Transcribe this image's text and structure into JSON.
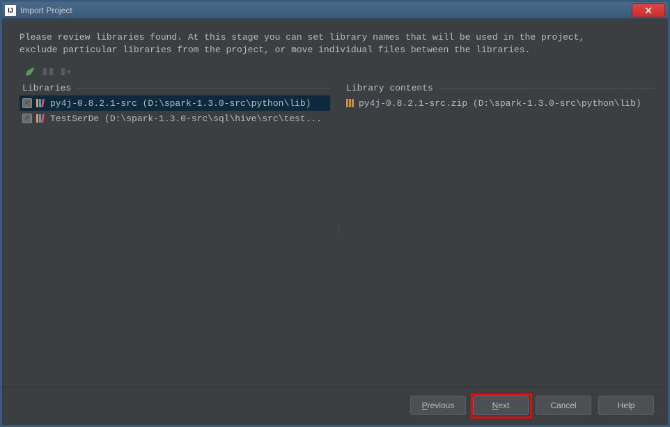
{
  "window": {
    "title": "Import Project",
    "app_icon_text": "IJ"
  },
  "instructions": {
    "line1": "Please review libraries found. At this stage you can set library names that will be used in the project,",
    "line2": "exclude particular libraries from the project, or move individual files between the libraries."
  },
  "toolbar": {
    "rename_icon": "rename",
    "split_icon": "split",
    "merge_icon": "merge"
  },
  "panels": {
    "libraries_label": "Libraries",
    "contents_label": "Library contents"
  },
  "libraries": [
    {
      "checked": true,
      "selected": true,
      "name": "py4j-0.8.2.1-src (D:\\spark-1.3.0-src\\python\\lib)"
    },
    {
      "checked": true,
      "selected": false,
      "name": "TestSerDe (D:\\spark-1.3.0-src\\sql\\hive\\src\\test..."
    }
  ],
  "library_contents": [
    {
      "name": "py4j-0.8.2.1-src.zip (D:\\spark-1.3.0-src\\python\\lib)"
    }
  ],
  "buttons": {
    "previous": "Previous",
    "next": "Next",
    "cancel": "Cancel",
    "help": "Help"
  }
}
